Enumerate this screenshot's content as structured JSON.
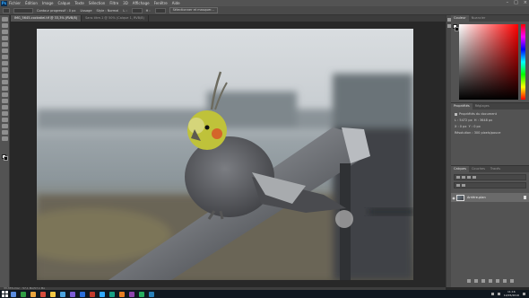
{
  "app": {
    "name": "Photoshop",
    "logo_text": "Ps"
  },
  "menubar": {
    "items": [
      "Fichier",
      "Édition",
      "Image",
      "Calque",
      "Texte",
      "Sélection",
      "Filtre",
      "3D",
      "Affichage",
      "Fenêtre",
      "Aide"
    ]
  },
  "optionsbar": {
    "items": [
      "Contour progressif : 0 px",
      "Lissage",
      "Style : Normal",
      "L :",
      "H :"
    ],
    "button": "Sélectionner et masquer..."
  },
  "tabs": [
    {
      "label": "IMG_5645-cockatiel.tif @ 33,3% (RVB/8)",
      "active": true
    },
    {
      "label": "Sans titre-1 @ 50% (Calque 1, RVB/8)",
      "active": false
    }
  ],
  "panels": {
    "color_tabs": [
      "Couleur",
      "Nuancier"
    ],
    "properties_tabs": [
      "Propriétés",
      "Réglages"
    ],
    "properties": {
      "title": "Propriétés du document",
      "w": "L : 5472 px",
      "h": "H : 3648 px",
      "x": "X : 0 px",
      "y": "Y : 0 px",
      "resolution": "Résolution : 300 pixels/pouce"
    },
    "layers_tabs": [
      "Calques",
      "Couches",
      "Tracés"
    ],
    "layer_name": "Arrière-plan"
  },
  "statusbar": {
    "text": "33,33%   Doc : 57,1 Mo/57,1 Mo"
  },
  "taskbar": {
    "time": "11:16",
    "date": "12/05/2016",
    "icon_colors": [
      "#5a8de0",
      "#2f9e44",
      "#e8a33d",
      "#d44c3c",
      "#f2c744",
      "#4aa3df",
      "#7b5cd6",
      "#2a6edb",
      "#c0392b",
      "#31a8ff",
      "#16a085",
      "#e67e22",
      "#8e44ad",
      "#27ae60",
      "#2980b9"
    ]
  },
  "colors": {
    "accent": "#31a8ff",
    "panel_bg": "#535353",
    "canvas_bg": "#282828"
  }
}
